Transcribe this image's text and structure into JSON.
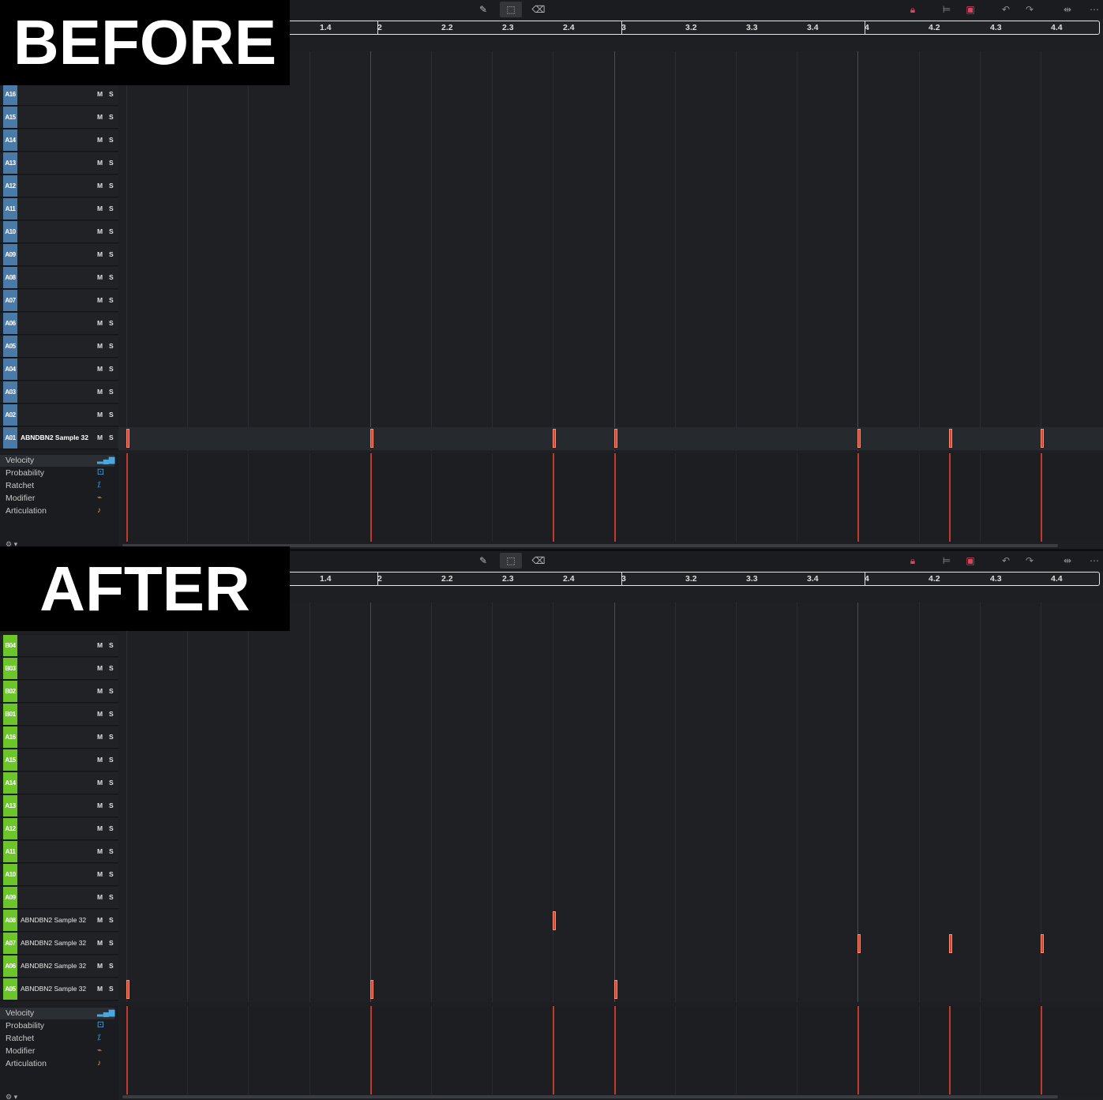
{
  "labels": {
    "before": "BEFORE",
    "after": "AFTER"
  },
  "toolbar": {
    "tools": [
      "pencil-icon",
      "select-icon",
      "eraser-icon"
    ],
    "right_tools": [
      "lock-icon",
      "align-icon",
      "fit-icon",
      "undo-icon",
      "redo-icon",
      "zoom-icon",
      "more-icon"
    ]
  },
  "ruler": {
    "labels": [
      "1.4",
      "2",
      "2.2",
      "2.3",
      "2.4",
      "3",
      "3.2",
      "3.3",
      "3.4",
      "4",
      "4.2",
      "4.3",
      "4.4"
    ]
  },
  "tracks_before": [
    {
      "id": "A16",
      "name": ""
    },
    {
      "id": "A15",
      "name": ""
    },
    {
      "id": "A14",
      "name": ""
    },
    {
      "id": "A13",
      "name": ""
    },
    {
      "id": "A12",
      "name": ""
    },
    {
      "id": "A11",
      "name": ""
    },
    {
      "id": "A10",
      "name": ""
    },
    {
      "id": "A09",
      "name": ""
    },
    {
      "id": "A08",
      "name": ""
    },
    {
      "id": "A07",
      "name": ""
    },
    {
      "id": "A06",
      "name": ""
    },
    {
      "id": "A05",
      "name": ""
    },
    {
      "id": "A04",
      "name": ""
    },
    {
      "id": "A03",
      "name": ""
    },
    {
      "id": "A02",
      "name": ""
    },
    {
      "id": "A01",
      "name": "ABNDBN2 Sample 32"
    }
  ],
  "tracks_after": [
    {
      "id": "B04",
      "name": ""
    },
    {
      "id": "B03",
      "name": ""
    },
    {
      "id": "B02",
      "name": ""
    },
    {
      "id": "B01",
      "name": ""
    },
    {
      "id": "A16",
      "name": ""
    },
    {
      "id": "A15",
      "name": ""
    },
    {
      "id": "A14",
      "name": ""
    },
    {
      "id": "A13",
      "name": ""
    },
    {
      "id": "A12",
      "name": ""
    },
    {
      "id": "A11",
      "name": ""
    },
    {
      "id": "A10",
      "name": ""
    },
    {
      "id": "A09",
      "name": ""
    },
    {
      "id": "A08",
      "name": "ABNDBN2 Sample 32"
    },
    {
      "id": "A07",
      "name": "ABNDBN2 Sample 32"
    },
    {
      "id": "A06",
      "name": "ABNDBN2 Sample 32"
    },
    {
      "id": "A05",
      "name": "ABNDBN2 Sample 32"
    }
  ],
  "mute_label": "M",
  "solo_label": "S",
  "lanes": [
    {
      "label": "Velocity",
      "icon": "velocity-icon"
    },
    {
      "label": "Probability",
      "icon": "probability-icon"
    },
    {
      "label": "Ratchet",
      "icon": "ratchet-icon"
    },
    {
      "label": "Modifier",
      "icon": "modifier-icon"
    },
    {
      "label": "Articulation",
      "icon": "articulation-icon"
    }
  ]
}
